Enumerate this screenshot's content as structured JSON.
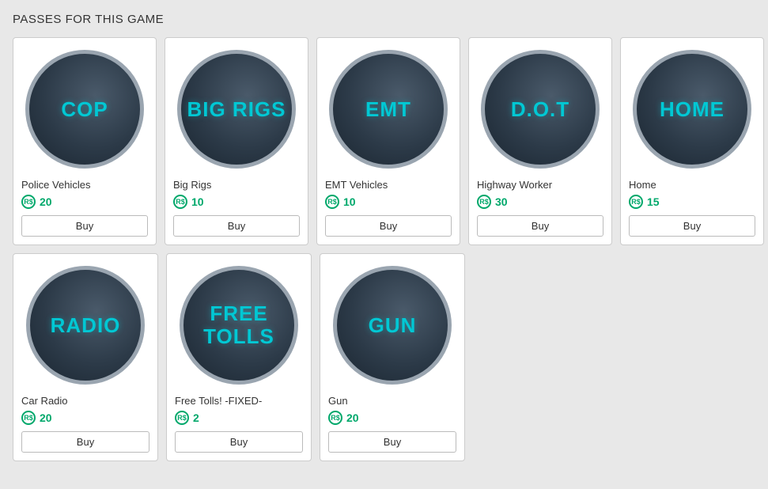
{
  "page": {
    "title": "PASSES FOR THIS GAME"
  },
  "passes": [
    {
      "id": "cop",
      "icon_text": "COP",
      "name": "Police Vehicles",
      "price": 20,
      "buy_label": "Buy"
    },
    {
      "id": "big-rigs",
      "icon_text": "BIG RIGS",
      "name": "Big Rigs",
      "price": 10,
      "buy_label": "Buy"
    },
    {
      "id": "emt",
      "icon_text": "EMT",
      "name": "EMT Vehicles",
      "price": 10,
      "buy_label": "Buy"
    },
    {
      "id": "dot",
      "icon_text": "D.O.T",
      "name": "Highway Worker",
      "price": 30,
      "buy_label": "Buy"
    },
    {
      "id": "home",
      "icon_text": "HOME",
      "name": "Home",
      "price": 15,
      "buy_label": "Buy"
    },
    {
      "id": "radio",
      "icon_text": "RADIO",
      "name": "Car Radio",
      "price": 20,
      "buy_label": "Buy"
    },
    {
      "id": "free-tolls",
      "icon_text": "FREE TOLLS",
      "name": "Free Tolls! -FIXED-",
      "price": 2,
      "buy_label": "Buy"
    },
    {
      "id": "gun",
      "icon_text": "GUN",
      "name": "Gun",
      "price": 20,
      "buy_label": "Buy"
    }
  ],
  "robux_symbol": "R$"
}
